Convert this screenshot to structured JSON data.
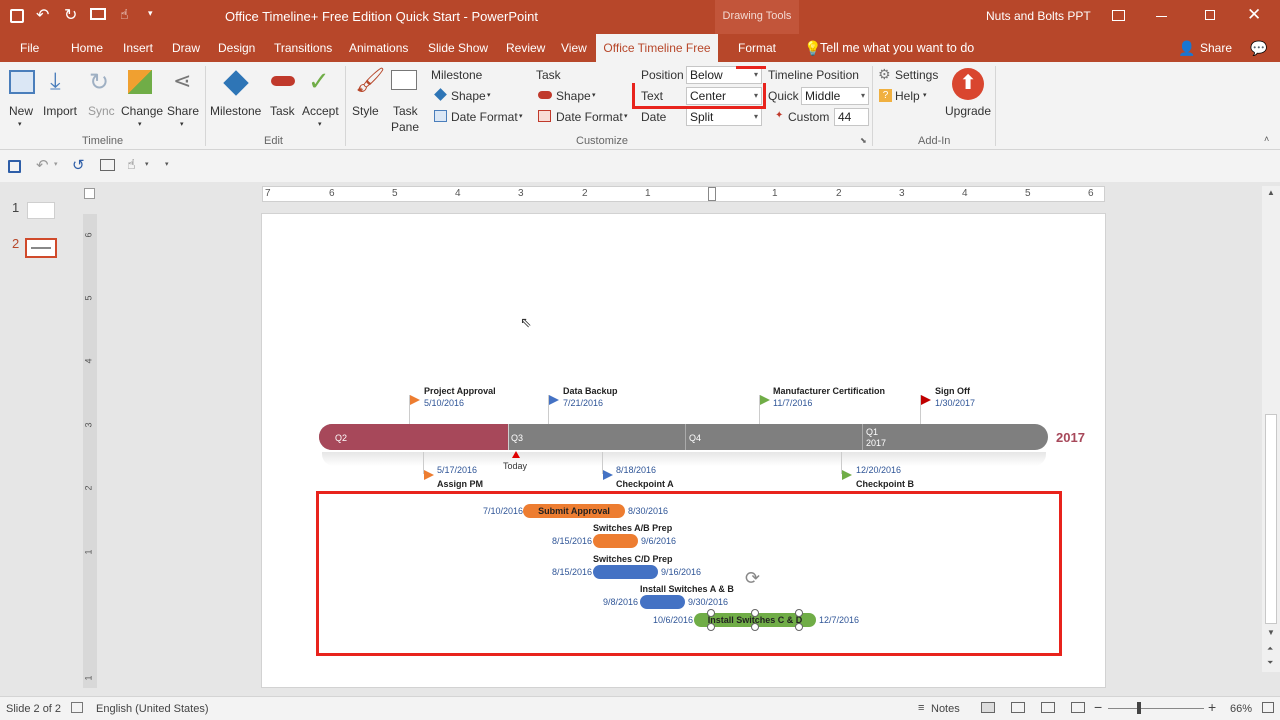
{
  "window": {
    "title": "Office Timeline+ Free Edition Quick Start - PowerPoint",
    "context_tool": "Drawing Tools",
    "account": "Nuts and Bolts PPT"
  },
  "tabs": [
    "File",
    "Home",
    "Insert",
    "Draw",
    "Design",
    "Transitions",
    "Animations",
    "Slide Show",
    "Review",
    "View",
    "Office Timeline Free",
    "Format"
  ],
  "tell_me": "Tell me what you want to do",
  "share_label": "Share",
  "ribbon": {
    "timeline_group": {
      "label": "Timeline",
      "buttons": [
        "New",
        "Import",
        "Sync",
        "Change",
        "Share"
      ]
    },
    "edit_group": {
      "label": "Edit",
      "buttons": [
        "Milestone",
        "Task",
        "Accept"
      ]
    },
    "customize_group": {
      "label": "Customize",
      "style": "Style",
      "task_pane": "Task",
      "task_pane2": "Pane",
      "milestone_title": "Milestone",
      "task_title": "Task",
      "shape": "Shape",
      "date_format": "Date Format",
      "position_label": "Position",
      "position_value": "Below",
      "text_label": "Text",
      "text_value": "Center",
      "date_label": "Date",
      "date_value": "Split",
      "timeline_position": "Timeline Position",
      "quick_label": "Quick",
      "quick_value": "Middle",
      "custom_label": "Custom",
      "custom_value": "44"
    },
    "addin_group": {
      "label": "Add-In",
      "settings": "Settings",
      "help": "Help",
      "upgrade": "Upgrade"
    }
  },
  "accent_color": "#b7472a",
  "thumbnails": [
    {
      "num": "1"
    },
    {
      "num": "2"
    }
  ],
  "hruler_ticks": [
    "7",
    "6",
    "5",
    "4",
    "3",
    "2",
    "1",
    "1",
    "2",
    "3",
    "4",
    "5",
    "6"
  ],
  "vruler_ticks": [
    "6",
    "5",
    "4",
    "3",
    "2",
    "1",
    "1"
  ],
  "timeline": {
    "year_label": "2017",
    "quarters": [
      {
        "label": "Q2"
      },
      {
        "label": "Q3"
      },
      {
        "label": "Q4"
      },
      {
        "label": "Q1",
        "sub": "2017"
      }
    ],
    "today": "Today",
    "milestones_above": [
      {
        "title": "Project Approval",
        "date": "5/10/2016",
        "color": "#ed7d31"
      },
      {
        "title": "Data Backup",
        "date": "7/21/2016",
        "color": "#4472c4"
      },
      {
        "title": "Manufacturer Certification",
        "date": "11/7/2016",
        "color": "#70ad47"
      },
      {
        "title": "Sign Off",
        "date": "1/30/2017",
        "color": "#c00000"
      }
    ],
    "milestones_below": [
      {
        "title": "Assign PM",
        "date": "5/17/2016",
        "color": "#ed7d31"
      },
      {
        "title": "Checkpoint A",
        "date": "8/18/2016",
        "color": "#4472c4"
      },
      {
        "title": "Checkpoint B",
        "date": "12/20/2016",
        "color": "#70ad47"
      }
    ],
    "tasks": [
      {
        "title": "Submit Approval",
        "start": "7/10/2016",
        "end": "8/30/2016",
        "color": "#ed7d31"
      },
      {
        "title": "Switches A/B Prep",
        "start": "8/15/2016",
        "end": "9/6/2016",
        "color": "#ed7d31"
      },
      {
        "title": "Switches C/D Prep",
        "start": "8/15/2016",
        "end": "9/16/2016",
        "color": "#4472c4"
      },
      {
        "title": "Install Switches A & B",
        "start": "9/8/2016",
        "end": "9/30/2016",
        "color": "#4472c4"
      },
      {
        "title": "Install Switches C & D",
        "start": "10/6/2016",
        "end": "12/7/2016",
        "color": "#70ad47"
      }
    ]
  },
  "status": {
    "slide": "Slide 2 of 2",
    "language": "English (United States)",
    "notes": "Notes",
    "zoom": "66%"
  }
}
